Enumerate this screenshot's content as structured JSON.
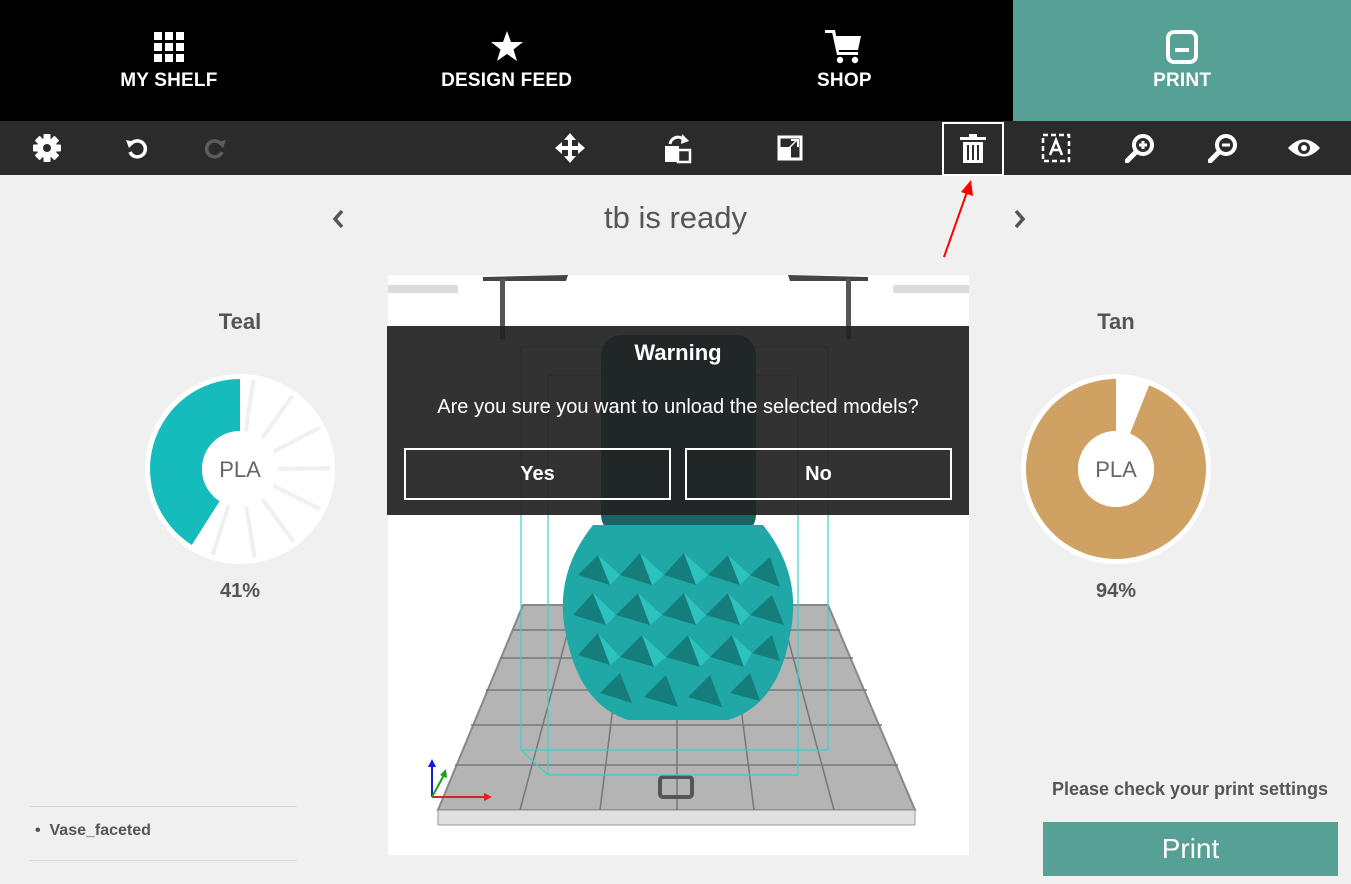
{
  "nav": {
    "tabs": [
      {
        "label": "MY SHELF",
        "icon": "grid-icon"
      },
      {
        "label": "DESIGN FEED",
        "icon": "star-icon"
      },
      {
        "label": "SHOP",
        "icon": "cart-icon"
      },
      {
        "label": "PRINT",
        "icon": "printer-icon",
        "active": true
      }
    ]
  },
  "toolbar": {
    "tools": [
      "settings-icon",
      "undo-icon",
      "redo-icon",
      "move-icon",
      "rotate-icon",
      "scale-icon",
      "delete-icon",
      "auto-layout-icon",
      "zoom-in-icon",
      "zoom-out-icon",
      "view-icon"
    ],
    "disabled": [
      "redo-icon"
    ],
    "highlighted": "delete-icon"
  },
  "header": {
    "title": "tb is ready"
  },
  "left_filament": {
    "name": "Teal",
    "material": "PLA",
    "percent_label": "41%",
    "percent": 41,
    "color": "#16bcbc"
  },
  "right_filament": {
    "name": "Tan",
    "material": "PLA",
    "percent_label": "94%",
    "percent": 94,
    "color": "#cfa264"
  },
  "dialog": {
    "title": "Warning",
    "message": "Are you sure you want to unload the selected models?",
    "yes": "Yes",
    "no": "No"
  },
  "models": {
    "items": [
      "Vase_faceted"
    ]
  },
  "print": {
    "settings_note": "Please check your print settings",
    "button": "Print"
  },
  "colors": {
    "accent": "#56a095",
    "toolbar": "#2b2b2b",
    "nav": "#000000",
    "annotation": "#ff0000"
  }
}
